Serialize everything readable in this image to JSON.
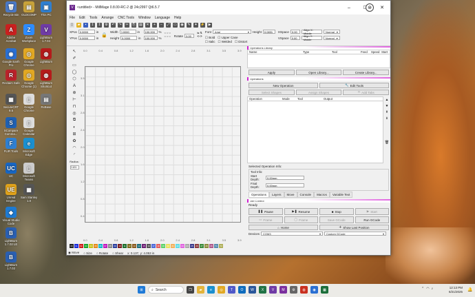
{
  "desktop": {
    "icons": [
      {
        "label": "Recycle Bin",
        "color": "#4a79c7",
        "glyph": "🗑"
      },
      {
        "label": "OLDCOMP",
        "color": "#c8a23a",
        "glyph": "▤"
      },
      {
        "label": "This PC",
        "color": "#2f7fd0",
        "glyph": "▣"
      },
      {
        "label": "Adobe Acrobat",
        "color": "#c9201f",
        "glyph": "A"
      },
      {
        "label": "Zoom Workplace",
        "color": "#2d8cff",
        "glyph": "Z"
      },
      {
        "label": "LightBurn 1.7.04",
        "color": "#6f3ba5",
        "glyph": "V"
      },
      {
        "label": "Google Earth Pro",
        "color": "#2a6fd2",
        "glyph": "◉"
      },
      {
        "label": "Google Chrome",
        "color": "#e2a823",
        "glyph": "◎"
      },
      {
        "label": "LightBurn",
        "color": "#b41b1b",
        "glyph": "◍"
      },
      {
        "label": "Reclaim Safe",
        "color": "#b9222a",
        "glyph": "R"
      },
      {
        "label": "Google Chrome (1)",
        "color": "#e2a823",
        "glyph": "◎"
      },
      {
        "label": "LightBurn Shortcut",
        "color": "#b41b1b",
        "glyph": "◍"
      },
      {
        "label": "SecureCRT 9.5",
        "color": "#555",
        "glyph": "▦"
      },
      {
        "label": "Google Chrome",
        "color": "#ddd",
        "glyph": "▯"
      },
      {
        "label": "RxBase",
        "color": "#777",
        "glyph": "▤"
      },
      {
        "label": "SCompare Comma...",
        "color": "#2060b0",
        "glyph": "S"
      },
      {
        "label": "Google Calendar",
        "color": "#ddd",
        "glyph": "▯"
      },
      {
        "label": "FLIR Tools",
        "color": "#2f7fd0",
        "glyph": "F"
      },
      {
        "label": "Microsoft Edge",
        "color": "#1a8fcf",
        "glyph": "e"
      },
      {
        "label": "UC",
        "color": "#1766c3",
        "glyph": "UC"
      },
      {
        "label": "Microsoft Teams",
        "color": "#ccc",
        "glyph": "▯"
      },
      {
        "label": "Unreal Engine",
        "color": "#e0a21b",
        "glyph": "UE"
      },
      {
        "label": "Sam Stanley 1.0",
        "color": "#555",
        "glyph": "▦"
      },
      {
        "label": "Visual Studio Code",
        "color": "#1e7ad1",
        "glyph": "◆"
      },
      {
        "label": "LightBurn 1.7.02 LE",
        "color": "#2a5fb0",
        "glyph": "B"
      },
      {
        "label": "LightBurn 1.7.02",
        "color": "#2a5fb0",
        "glyph": "B"
      }
    ]
  },
  "window": {
    "title": "<untitled> - MillMage 0.8.00-RC-2 @ 24c2997 Qt6.5.7",
    "menu": [
      "File",
      "Edit",
      "Tools",
      "Arrange",
      "CNC Tools",
      "Window",
      "Language",
      "Help"
    ],
    "props": {
      "xpos_label": "XPos",
      "xpos": "0.0000",
      "ypos_label": "YPos",
      "ypos": "0.0000",
      "width_label": "Width",
      "width": "0.0000",
      "height_label": "Height",
      "height": "0.0000",
      "unit": "in",
      "pct1": "100.000",
      "pct2": "100.000",
      "pct_sym": "%",
      "rotate_label": "Rotate",
      "rotate": "0.00",
      "font_label": "Font",
      "font": "Arial",
      "fheight_label": "Height",
      "fheight": "0.0831",
      "bold": "Bold",
      "italic": "Italic",
      "upper": "Upper Case",
      "welded": "Welded",
      "distort": "Distort",
      "hspace_label": "HSpace",
      "hspace": "0.00",
      "vspace_label": "VSpace",
      "vspace": "0.00",
      "alignx": "Align X: Middle",
      "aligny": "Align Y: Middle",
      "normal1": "Normal",
      "normal2": "Normal"
    },
    "ruler_top": [
      "0.0",
      "0.4",
      "0.8",
      "1.2",
      "1.6",
      "2.0",
      "2.4",
      "2.8",
      "3.1",
      "3.5",
      "3.9"
    ],
    "ruler_left": [
      "3.5",
      "3.1",
      "2.8",
      "2.4",
      "2.0",
      "1.6",
      "1.2",
      "0.8",
      "0.4"
    ],
    "ruler_bottom": [
      "0.0",
      "0.4",
      "0.8",
      "1.2",
      "1.6",
      "2.0",
      "2.4",
      "2.8",
      "3.1",
      "3.5",
      "3.9"
    ],
    "radius_label": "Radius:",
    "radius_value": "0.101",
    "palette": [
      {
        "c": "#222",
        "t": "00"
      },
      {
        "c": "#1a2bd8",
        "t": "01"
      },
      {
        "c": "#d11b1b",
        "t": "02"
      },
      {
        "c": "#16a32a",
        "t": "03"
      },
      {
        "c": "#c7c11a",
        "t": "04"
      },
      {
        "c": "#e48a1c",
        "t": "05"
      },
      {
        "c": "#12b8c9",
        "t": "06"
      },
      {
        "c": "#c01cc0",
        "t": "07"
      },
      {
        "c": "#888",
        "t": "08"
      },
      {
        "c": "#2b3f9e",
        "t": "09"
      },
      {
        "c": "#7a1f1f",
        "t": "10"
      },
      {
        "c": "#1f6e2d",
        "t": "11"
      },
      {
        "c": "#7c6a1a",
        "t": "12"
      },
      {
        "c": "#8a5a20",
        "t": "13"
      },
      {
        "c": "#1c6d7a",
        "t": "14"
      },
      {
        "c": "#6b1f73",
        "t": "15"
      },
      {
        "c": "#555",
        "t": "16"
      },
      {
        "c": "#4f6bd8",
        "t": "17"
      },
      {
        "c": "#e26060",
        "t": "18"
      },
      {
        "c": "#5ed16a",
        "t": "19"
      },
      {
        "c": "#e9e25e",
        "t": "20"
      },
      {
        "c": "#f2b15e",
        "t": "21"
      },
      {
        "c": "#63dbe6",
        "t": "22"
      },
      {
        "c": "#e066e0",
        "t": "23"
      },
      {
        "c": "#aaa",
        "t": "24"
      },
      {
        "c": "#3c3c8c",
        "t": "25"
      },
      {
        "c": "#8c3c3c",
        "t": "26"
      },
      {
        "c": "#3c8c3c",
        "t": "27"
      },
      {
        "c": "#8c8c3c",
        "t": "28"
      },
      {
        "c": "#b05a8c",
        "t": "29"
      },
      {
        "c": "#5a8cb0",
        "t": "T1"
      },
      {
        "c": "#b0b05a",
        "t": "T2"
      }
    ],
    "status": {
      "move": "Move",
      "size": "Size",
      "rotate": "Rotate",
      "shear": "Shear",
      "coords": "x: 0.137, y: 4.053 in"
    },
    "oplib": {
      "title": "Operations Library",
      "cols": [
        "Name",
        "Type",
        "Tool",
        "Feed",
        "Speed",
        "Start"
      ],
      "apply": "Apply",
      "open": "Open Library...",
      "create": "Create Library..."
    },
    "operations": {
      "title": "Operations",
      "new_op": "New Operation",
      "edit_tools": "Edit Tools",
      "select_shapes": "Select Shapes",
      "assign_shapes": "Assign Shapes",
      "add_tabs": "Add Tabs",
      "cols": [
        "Operation",
        "Mode",
        "Tool",
        "Output"
      ],
      "selected_info": "Selected Operation Info:",
      "tool_info": "Tool Info:",
      "start_depth_label": "Start Depth:",
      "start_depth": "0.00mm",
      "final_depth_label": "Final Depth:",
      "final_depth": "0.00mm"
    },
    "tabs": [
      "Operations",
      "Layers",
      "Move",
      "Console",
      "Macros",
      "Variable Text"
    ],
    "job": {
      "title": "Job Control",
      "ready": "Ready",
      "pause": "Pause",
      "resume": "Resume",
      "stop": "Stop",
      "start": "Start",
      "frame1": "Frame",
      "frame2": "Frame",
      "save_gcode": "Save GCode",
      "run_gcode": "Run GCode",
      "home": "Home",
      "show_last": "Show Last Position",
      "devices_label": "Devices",
      "port": "COM3",
      "device": "Custom GCode"
    }
  },
  "taskbar": {
    "search": "Search",
    "time": "12:13 PM",
    "date": "6/21/2025"
  }
}
